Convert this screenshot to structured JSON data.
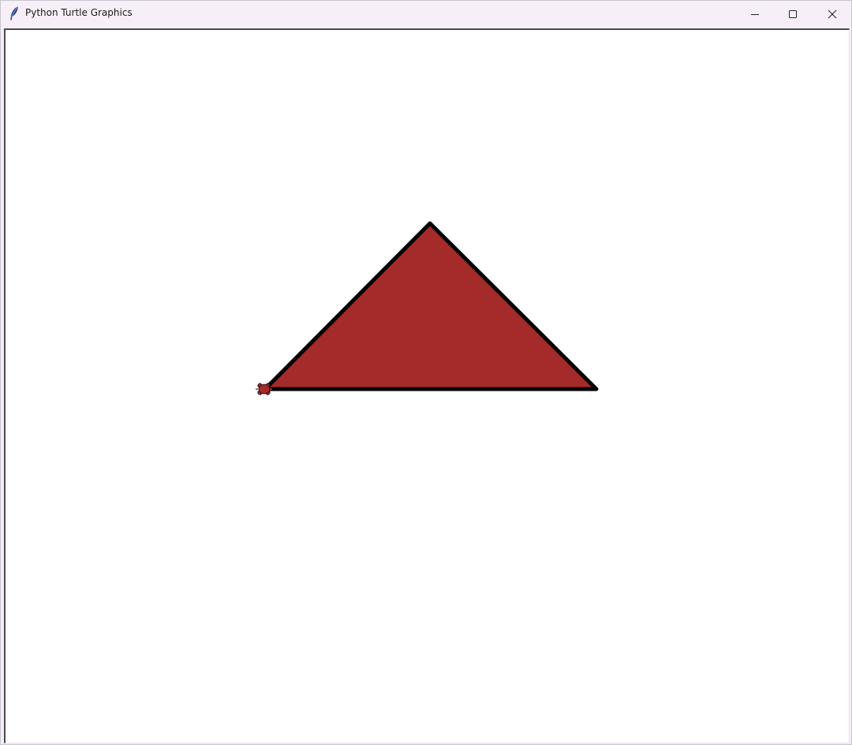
{
  "window": {
    "title": "Python Turtle Graphics",
    "app_icon": "feather-icon",
    "controls": {
      "minimize_icon": "minimize-icon",
      "maximize_icon": "maximize-icon",
      "close_icon": "close-icon"
    }
  },
  "canvas": {
    "background": "#ffffff",
    "shape": {
      "type": "triangle",
      "fill_color": "#a52a2a",
      "outline_color": "#000000"
    },
    "turtle": {
      "icon": "turtle-icon",
      "fill_color": "#a52a2a",
      "outline_color": "#000000"
    }
  }
}
